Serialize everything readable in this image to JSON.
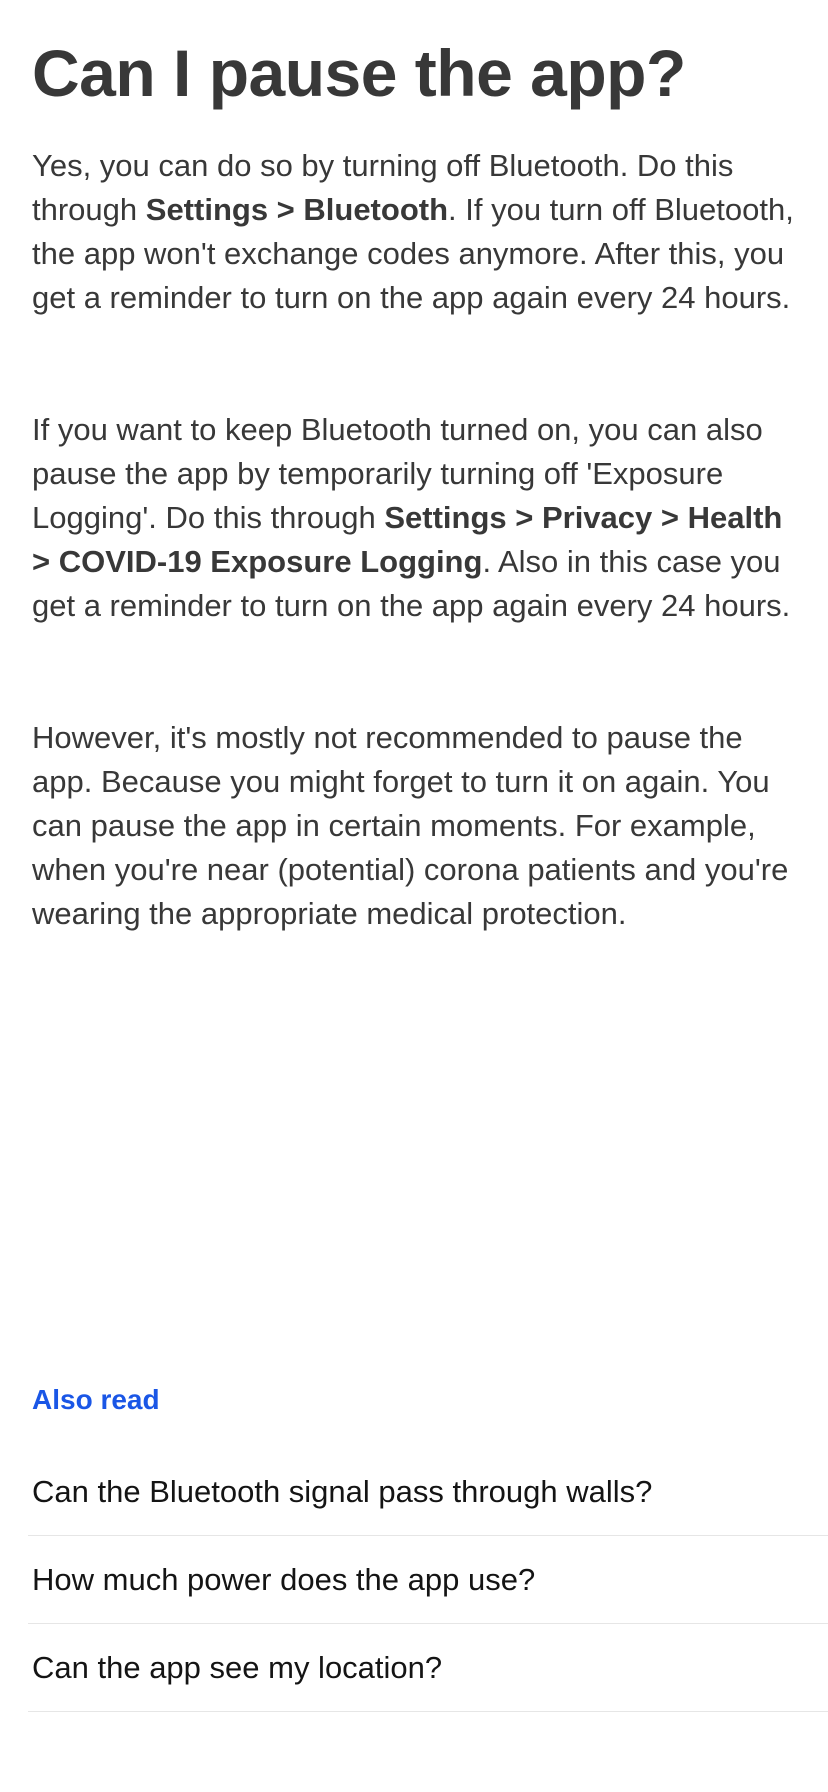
{
  "article": {
    "title": "Can I pause the app?",
    "para1": {
      "t1": "Yes, you can do so by turning off Bluetooth. Do this through ",
      "b1": "Settings > Bluetooth",
      "t2": ". If you turn off Bluetooth, the app won't exchange codes anymore. After this, you get a reminder to turn on the app again every 24 hours."
    },
    "para2": {
      "t1": "If you want to keep Bluetooth turned on, you can also pause the app by temporarily turning off 'Exposure Logging'. Do this through ",
      "b1": "Settings > Privacy > Health > COVID-19 Exposure Logging",
      "t2": ". Also in this case you get a reminder to turn on the app again every 24 hours."
    },
    "para3": {
      "t1": "However, it's mostly not recommended to pause the app. Because you might forget to turn it on again. You can pause the app in certain moments. For example, when you're near (potential) corona patients and you're wearing the appropriate medical protection."
    }
  },
  "also_read": {
    "label": "Also read",
    "accent_color": "#1a56e6",
    "items": [
      {
        "label": "Can the Bluetooth signal pass through walls?"
      },
      {
        "label": "How much power does the app use?"
      },
      {
        "label": "Can the app see my location?"
      }
    ]
  }
}
